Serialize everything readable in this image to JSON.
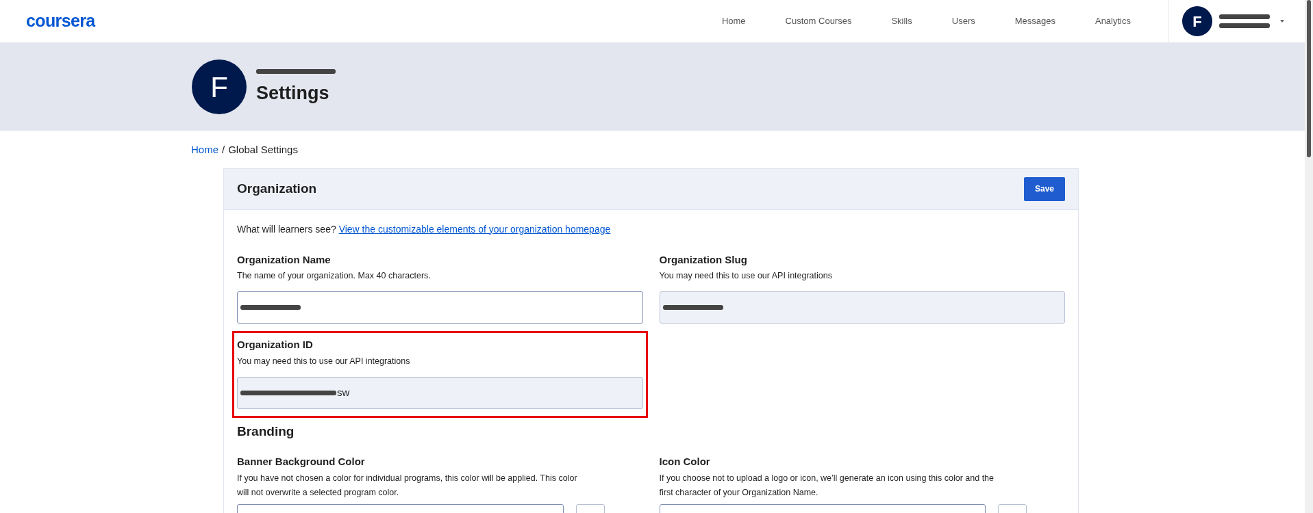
{
  "header": {
    "logo": "coursera",
    "nav": [
      {
        "label": "Home",
        "selected": false
      },
      {
        "label": "Custom Courses",
        "selected": false
      },
      {
        "label": "Skills",
        "selected": false
      },
      {
        "label": "Users",
        "selected": false
      },
      {
        "label": "Messages",
        "selected": false
      },
      {
        "label": "Analytics",
        "selected": false
      }
    ],
    "user": {
      "initial": "F",
      "redacted": true
    }
  },
  "banner": {
    "initial": "F",
    "redacted": true,
    "title": "Settings"
  },
  "breadcrumb": {
    "link": "Home",
    "separator": "/",
    "current": "Global Settings"
  },
  "card": {
    "title": "Organization",
    "save": "Save",
    "intro": "What will learners see?",
    "intro_link": "View the customizable elements of your organization homepage",
    "fields": [
      {
        "kind": "text",
        "label": "Organization Name",
        "hint": "The name of your organization. Max 40 characters.",
        "redacted": true,
        "readonly": false,
        "highlighted": false
      },
      {
        "kind": "text",
        "label": "Organization Slug",
        "hint": "You may need this to use our API integrations",
        "redacted": true,
        "readonly": true,
        "highlighted": false
      },
      {
        "kind": "text",
        "label": "Organization ID",
        "hint": "You may need this to use our API integrations",
        "redacted": true,
        "value": "sw",
        "readonly": true,
        "highlighted": true
      }
    ],
    "branding_title": "Branding",
    "branding_fields": [
      {
        "kind": "color",
        "label": "Banner Background Color",
        "hint": "If you have not chosen a color for individual programs, this color will be applied. This color will not overwrite a selected program color."
      },
      {
        "kind": "color",
        "label": "Icon Color",
        "hint": "If you choose not to upload a logo or icon, we’ll generate an icon using this color and the first character of your Organization Name."
      }
    ]
  }
}
